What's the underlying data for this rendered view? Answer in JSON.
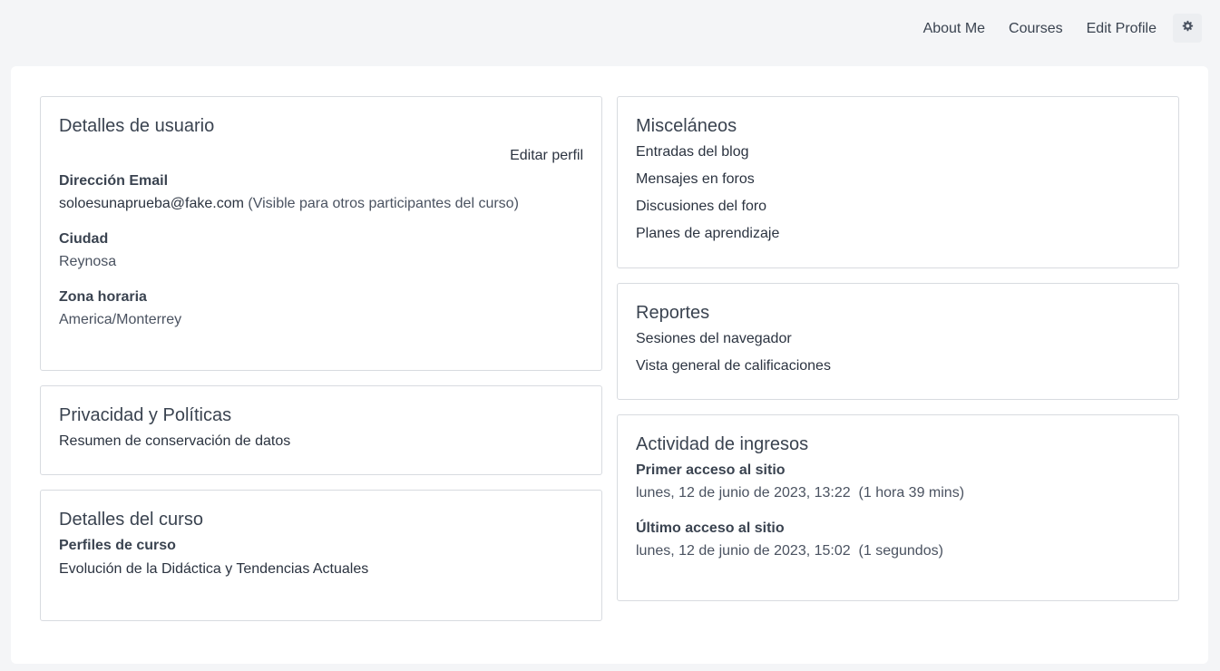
{
  "topnav": {
    "about": "About Me",
    "courses": "Courses",
    "edit_profile": "Edit Profile"
  },
  "user_details": {
    "title": "Detalles de usuario",
    "edit_link": "Editar perfil",
    "email_label": "Dirección Email",
    "email_value": "soloesunaprueba@fake.com",
    "email_visibility": "(Visible para otros participantes del curso)",
    "city_label": "Ciudad",
    "city_value": "Reynosa",
    "timezone_label": "Zona horaria",
    "timezone_value": "America/Monterrey"
  },
  "privacy": {
    "title": "Privacidad y Políticas",
    "link": "Resumen de conservación de datos"
  },
  "course_details": {
    "title": "Detalles del curso",
    "profiles_label": "Perfiles de curso",
    "course_link": "Evolución de la Didáctica y Tendencias Actuales"
  },
  "misc": {
    "title": "Misceláneos",
    "items": [
      "Entradas del blog",
      "Mensajes en foros",
      "Discusiones del foro",
      "Planes de aprendizaje"
    ]
  },
  "reports": {
    "title": "Reportes",
    "items": [
      "Sesiones del navegador",
      "Vista general de calificaciones"
    ]
  },
  "login_activity": {
    "title": "Actividad de ingresos",
    "first_label": "Primer acceso al sitio",
    "first_value": "lunes, 12 de junio de 2023, 13:22  (1 hora 39 mins)",
    "last_label": "Último acceso al sitio",
    "last_value": "lunes, 12 de junio de 2023, 15:02  (1 segundos)"
  }
}
